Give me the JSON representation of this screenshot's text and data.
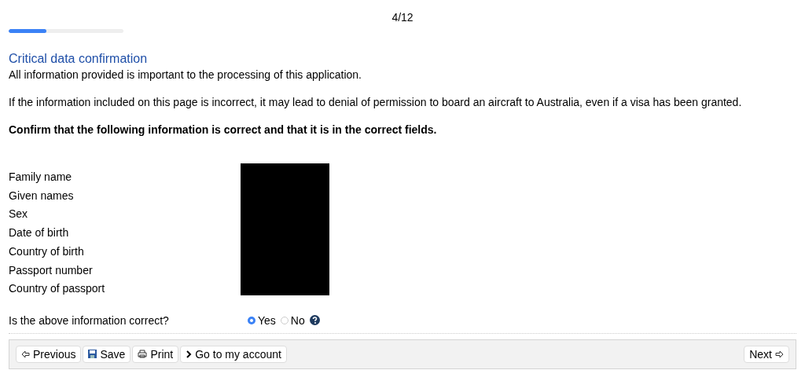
{
  "progress": {
    "step": "4/12",
    "level": 0.33
  },
  "section": {
    "title": "Critical data confirmation",
    "intro": "All information provided is important to the processing of this application.",
    "warning": "If the information included on this page is incorrect, it may lead to denial of permission to board an aircraft to Australia, even if a visa has been granted.",
    "instruction": "Confirm that the following information is correct and that it is in the correct fields."
  },
  "fields": [
    "Family name",
    "Given names",
    "Sex",
    "Date of birth",
    "Country of birth",
    "Passport number",
    "Country of passport"
  ],
  "question": {
    "label": "Is the above information correct?",
    "options": [
      {
        "label": "Yes",
        "selected": true
      },
      {
        "label": "No",
        "selected": false
      }
    ]
  },
  "footer": {
    "left": [
      {
        "kind": "previous",
        "label": "Previous"
      },
      {
        "kind": "save",
        "label": "Save"
      },
      {
        "kind": "print",
        "label": "Print"
      },
      {
        "kind": "account",
        "label": "Go to my account"
      }
    ],
    "right": [
      {
        "kind": "next",
        "label": "Next"
      }
    ]
  }
}
